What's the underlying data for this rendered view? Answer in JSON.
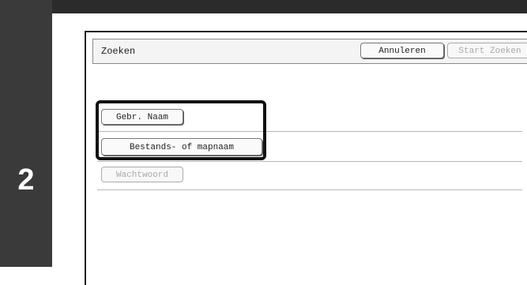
{
  "step": {
    "number": "2"
  },
  "window": {
    "title": "Zoeken",
    "cancel_label": "Annuleren",
    "start_label": "Start Zoeken"
  },
  "criteria": {
    "user_name": "Gebr. Naam",
    "file_folder_name": "Bestands- of mapnaam",
    "password": "Wachtwoord"
  },
  "colors": {
    "step_bar": "#3a3a3a",
    "highlight_border": "#111111"
  }
}
